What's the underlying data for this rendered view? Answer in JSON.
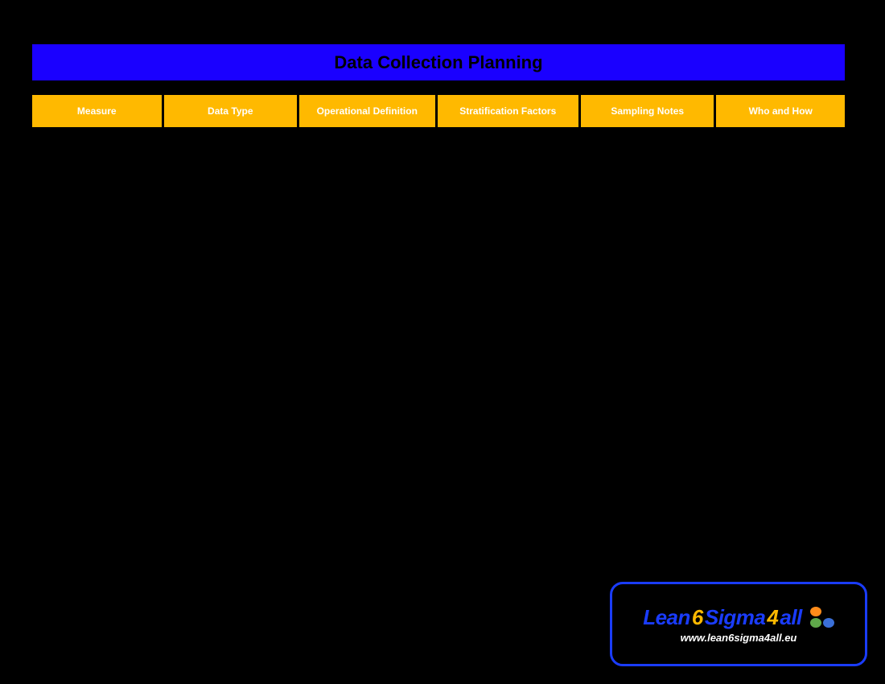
{
  "title": "Data Collection Planning",
  "headers": {
    "h1": "Measure",
    "h2": "Data Type",
    "h3": "Operational Definition",
    "h4": "Stratification Factors",
    "h5": "Sampling Notes",
    "h6": "Who and How"
  },
  "logo": {
    "lean": "Lean",
    "six": "6",
    "sigma": "Sigma",
    "four": "4",
    "all": "all",
    "url": "www.lean6sigma4all.eu"
  }
}
